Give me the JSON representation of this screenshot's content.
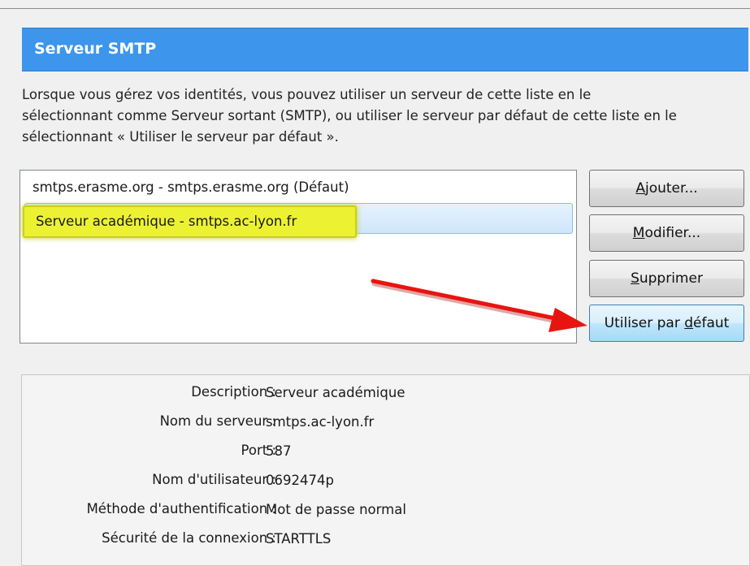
{
  "header": {
    "title": "Serveur SMTP"
  },
  "description": {
    "lines": [
      "Lorsque vous gérez vos identités, vous pouvez utiliser un serveur de cette liste en le",
      "sélectionnant comme Serveur sortant (SMTP), ou utiliser le serveur par défaut de cette liste en le",
      "sélectionnant « Utiliser le serveur par défaut »."
    ]
  },
  "servers": {
    "items": [
      {
        "label": "smtps.erasme.org - smtps.erasme.org (Défaut)",
        "selected": false
      },
      {
        "label": "Serveur académique - smtps.ac-lyon.fr",
        "selected": true
      }
    ]
  },
  "buttons": {
    "add": {
      "pre": "",
      "key": "A",
      "post": "jouter..."
    },
    "edit": {
      "pre": "",
      "key": "M",
      "post": "odifier..."
    },
    "delete": {
      "pre": "",
      "key": "S",
      "post": "upprimer"
    },
    "set_default": {
      "pre": "Utiliser par ",
      "key": "d",
      "post": "éfaut"
    }
  },
  "annotation": {
    "arrow_color": "#e8140f",
    "highlight_color": "#ecf232"
  },
  "details": {
    "description": {
      "label": "Description :",
      "value": "Serveur académique"
    },
    "server_name": {
      "label": "Nom du serveur :",
      "value": "smtps.ac-lyon.fr"
    },
    "port": {
      "label": "Port :",
      "value": "587"
    },
    "username": {
      "label": "Nom d'utilisateur :",
      "value": "0692474p"
    },
    "auth_method": {
      "label": "Méthode d'authentification :",
      "value": "Mot de passe normal"
    },
    "security": {
      "label": "Sécurité de la connexion :",
      "value": "STARTTLS"
    }
  }
}
